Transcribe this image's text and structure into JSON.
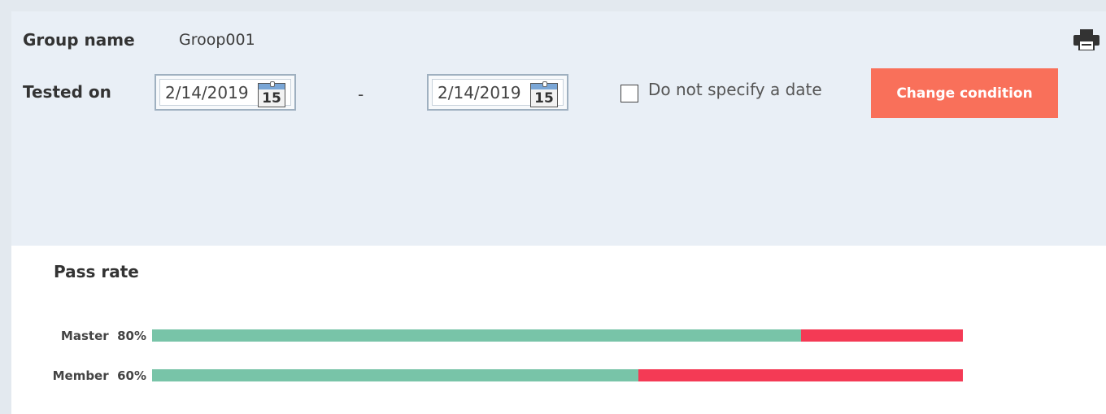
{
  "filter": {
    "group_label": "Group name",
    "group_value": "Groop001",
    "tested_label": "Tested on",
    "date_from": "2/14/2019",
    "date_to": "2/14/2019",
    "calendar_day": "15",
    "range_separator": "-",
    "no_date_label": "Do not specify a date",
    "no_date_checked": false,
    "change_button": "Change condition"
  },
  "icons": {
    "print": "print-icon",
    "calendar": "calendar-icon"
  },
  "colors": {
    "pass": "#78c4a8",
    "fail": "#f43a55",
    "button": "#f9705a"
  },
  "pass_rate": {
    "title": "Pass rate",
    "rows": [
      {
        "name": "Master",
        "rate_label": "80%",
        "rate": 0.8
      },
      {
        "name": "Member",
        "rate_label": "60%",
        "rate": 0.6
      }
    ]
  }
}
